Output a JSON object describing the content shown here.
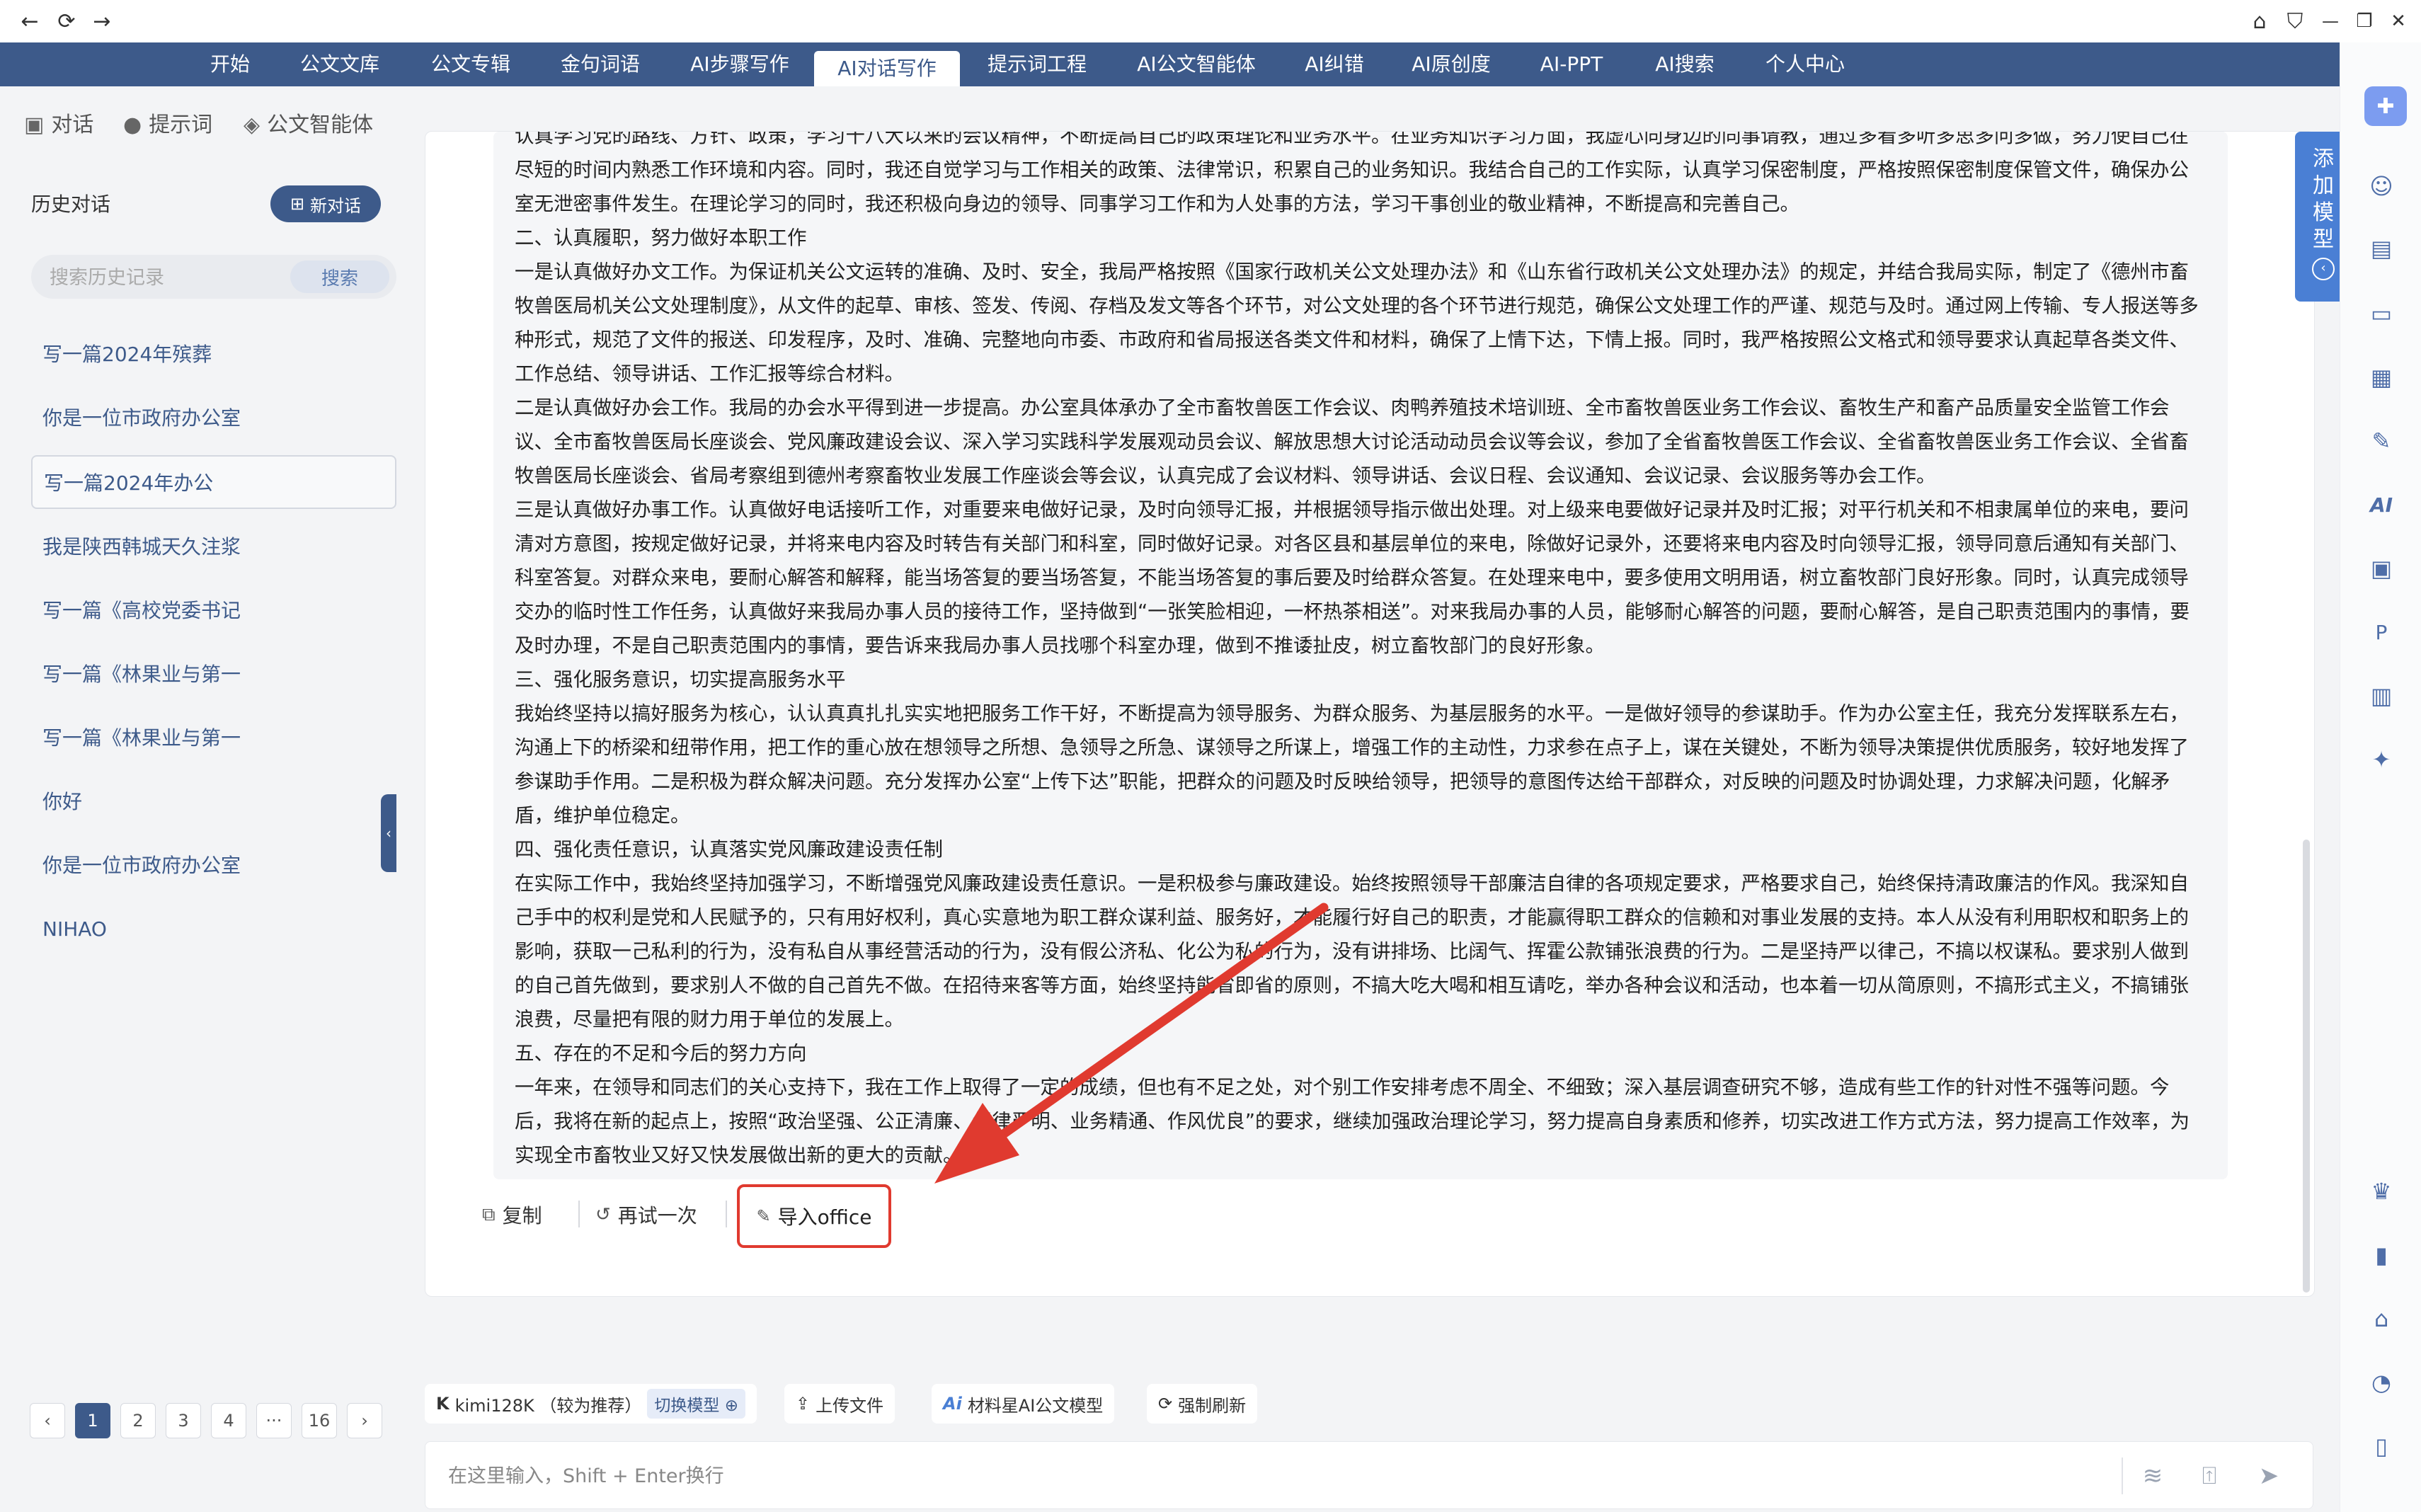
{
  "browser": {
    "back_icon": "←",
    "reload_icon": "⟳",
    "forward_icon": "→",
    "home_icon": "⌂",
    "shield_icon": "⛉",
    "minimize_icon": "—",
    "restore_icon": "❐",
    "close_icon": "✕"
  },
  "nav": {
    "items": [
      "开始",
      "公文文库",
      "公文专辑",
      "金句词语",
      "AI步骤写作",
      "AI对话写作",
      "提示词工程",
      "AI公文智能体",
      "AI纠错",
      "AI原创度",
      "AI-PPT",
      "AI搜索",
      "个人中心"
    ],
    "active": "AI对话写作"
  },
  "sidebar": {
    "tabs": [
      {
        "label": "对话",
        "icon": "chat-icon"
      },
      {
        "label": "提示词",
        "icon": "bulb-icon"
      },
      {
        "label": "公文智能体",
        "icon": "cube-icon"
      }
    ],
    "history_title": "历史对话",
    "new_chat_label": "新对话",
    "search_placeholder": "搜索历史记录",
    "search_button": "搜索",
    "history": [
      "写一篇2024年殡葬",
      "你是一位市政府办公室",
      "写一篇2024年办公",
      "我是陕西韩城天久注浆",
      "写一篇《高校党委书记",
      "写一篇《林果业与第一",
      "写一篇《林果业与第一",
      "你好",
      "你是一位市政府办公室",
      "NIHAO"
    ],
    "selected_index": 2,
    "pagination": {
      "prev": "‹",
      "pages": [
        "1",
        "2",
        "3",
        "4",
        "···",
        "16"
      ],
      "next": "›",
      "current": "1"
    }
  },
  "message": {
    "paragraphs": [
      "认真学习党的路线、方针、政策，学习十八大以来的会议精神，不断提高自己的政策理论和业务水平。在业务知识学习方面，我虚心向身边的同事请教，通过多看多听多思多问多做，努力使自己在尽短的时间内熟悉工作环境和内容。同时，我还自觉学习与工作相关的政策、法律常识，积累自己的业务知识。我结合自己的工作实际，认真学习保密制度，严格按照保密制度保管文件，确保办公室无泄密事件发生。在理论学习的同时，我还积极向身边的领导、同事学习工作和为人处事的方法，学习干事创业的敬业精神，不断提高和完善自己。",
      "二、认真履职，努力做好本职工作",
      "一是认真做好办文工作。为保证机关公文运转的准确、及时、安全，我局严格按照《国家行政机关公文处理办法》和《山东省行政机关公文处理办法》的规定，并结合我局实际，制定了《德州市畜牧兽医局机关公文处理制度》，从文件的起草、审核、签发、传阅、存档及发文等各个环节，对公文处理的各个环节进行规范，确保公文处理工作的严谨、规范与及时。通过网上传输、专人报送等多种形式，规范了文件的报送、印发程序，及时、准确、完整地向市委、市政府和省局报送各类文件和材料，确保了上情下达，下情上报。同时，我严格按照公文格式和领导要求认真起草各类文件、工作总结、领导讲话、工作汇报等综合材料。",
      "二是认真做好办会工作。我局的办会水平得到进一步提高。办公室具体承办了全市畜牧兽医工作会议、肉鸭养殖技术培训班、全市畜牧兽医业务工作会议、畜牧生产和畜产品质量安全监管工作会议、全市畜牧兽医局长座谈会、党风廉政建设会议、深入学习实践科学发展观动员会议、解放思想大讨论活动动员会议等会议，参加了全省畜牧兽医工作会议、全省畜牧兽医业务工作会议、全省畜牧兽医局长座谈会、省局考察组到德州考察畜牧业发展工作座谈会等会议，认真完成了会议材料、领导讲话、会议日程、会议通知、会议记录、会议服务等办会工作。",
      "三是认真做好办事工作。认真做好电话接听工作，对重要来电做好记录，及时向领导汇报，并根据领导指示做出处理。对上级来电要做好记录并及时汇报；对平行机关和不相隶属单位的来电，要问清对方意图，按规定做好记录，并将来电内容及时转告有关部门和科室，同时做好记录。对各区县和基层单位的来电，除做好记录外，还要将来电内容及时向领导汇报，领导同意后通知有关部门、科室答复。对群众来电，要耐心解答和解释，能当场答复的要当场答复，不能当场答复的事后要及时给群众答复。在处理来电中，要多使用文明用语，树立畜牧部门良好形象。同时，认真完成领导交办的临时性工作任务，认真做好来我局办事人员的接待工作，坚持做到“一张笑脸相迎，一杯热茶相送”。对来我局办事的人员，能够耐心解答的问题，要耐心解答，是自己职责范围内的事情，要及时办理，不是自己职责范围内的事情，要告诉来我局办事人员找哪个科室办理，做到不推诿扯皮，树立畜牧部门的良好形象。",
      "三、强化服务意识，切实提高服务水平",
      "我始终坚持以搞好服务为核心，认认真真扎扎实实地把服务工作干好，不断提高为领导服务、为群众服务、为基层服务的水平。一是做好领导的参谋助手。作为办公室主任，我充分发挥联系左右，沟通上下的桥梁和纽带作用，把工作的重心放在想领导之所想、急领导之所急、谋领导之所谋上，增强工作的主动性，力求参在点子上，谋在关键处，不断为领导决策提供优质服务，较好地发挥了参谋助手作用。二是积极为群众解决问题。充分发挥办公室“上传下达”职能，把群众的问题及时反映给领导，把领导的意图传达给干部群众，对反映的问题及时协调处理，力求解决问题，化解矛盾，维护单位稳定。",
      "四、强化责任意识，认真落实党风廉政建设责任制",
      "在实际工作中，我始终坚持加强学习，不断增强党风廉政建设责任意识。一是积极参与廉政建设。始终按照领导干部廉洁自律的各项规定要求，严格要求自己，始终保持清政廉洁的作风。我深知自己手中的权利是党和人民赋予的，只有用好权利，真心实意地为职工群众谋利益、服务好，才能履行好自己的职责，才能赢得职工群众的信赖和对事业发展的支持。本人从没有利用职权和职务上的影响，获取一己私利的行为，没有私自从事经营活动的行为，没有假公济私、化公为私的行为，没有讲排场、比阔气、挥霍公款铺张浪费的行为。二是坚持严以律己，不搞以权谋私。要求别人做到的自己首先做到，要求别人不做的自己首先不做。在招待来客等方面，始终坚持能省即省的原则，不搞大吃大喝和相互请吃，举办各种会议和活动，也本着一切从简原则，不搞形式主义，不搞铺张浪费，尽量把有限的财力用于单位的发展上。",
      "五、存在的不足和今后的努力方向",
      "一年来，在领导和同志们的关心支持下，我在工作上取得了一定的成绩，但也有不足之处，对个别工作安排考虑不周全、不细致；深入基层调查研究不够，造成有些工作的针对性不强等问题。今后，我将在新的起点上，按照“政治坚强、公正清廉、纪律严明、业务精通、作风优良”的要求，继续加强政治理论学习，努力提高自身素质和修养，切实改进工作方式方法，努力提高工作效率，为实现全市畜牧业又好又快发展做出新的更大的贡献。"
    ]
  },
  "actions": {
    "copy": "复制",
    "retry": "再试一次",
    "import_office": "导入office"
  },
  "add_model": {
    "chars": [
      "添",
      "加",
      "模",
      "型"
    ],
    "back_icon": "‹"
  },
  "toolbar": {
    "model_label": "kimi128K （较为推荐）",
    "switch_model": "切换模型 ⊕",
    "upload": "上传文件",
    "material_model": "材料星AI公文模型",
    "force_refresh": "强制刷新"
  },
  "input": {
    "placeholder": "在这里输入，Shift + Enter换行"
  },
  "colors": {
    "nav_bg": "#3d5a8a",
    "accent": "#4a7fd4",
    "highlight": "#e03a2f"
  }
}
